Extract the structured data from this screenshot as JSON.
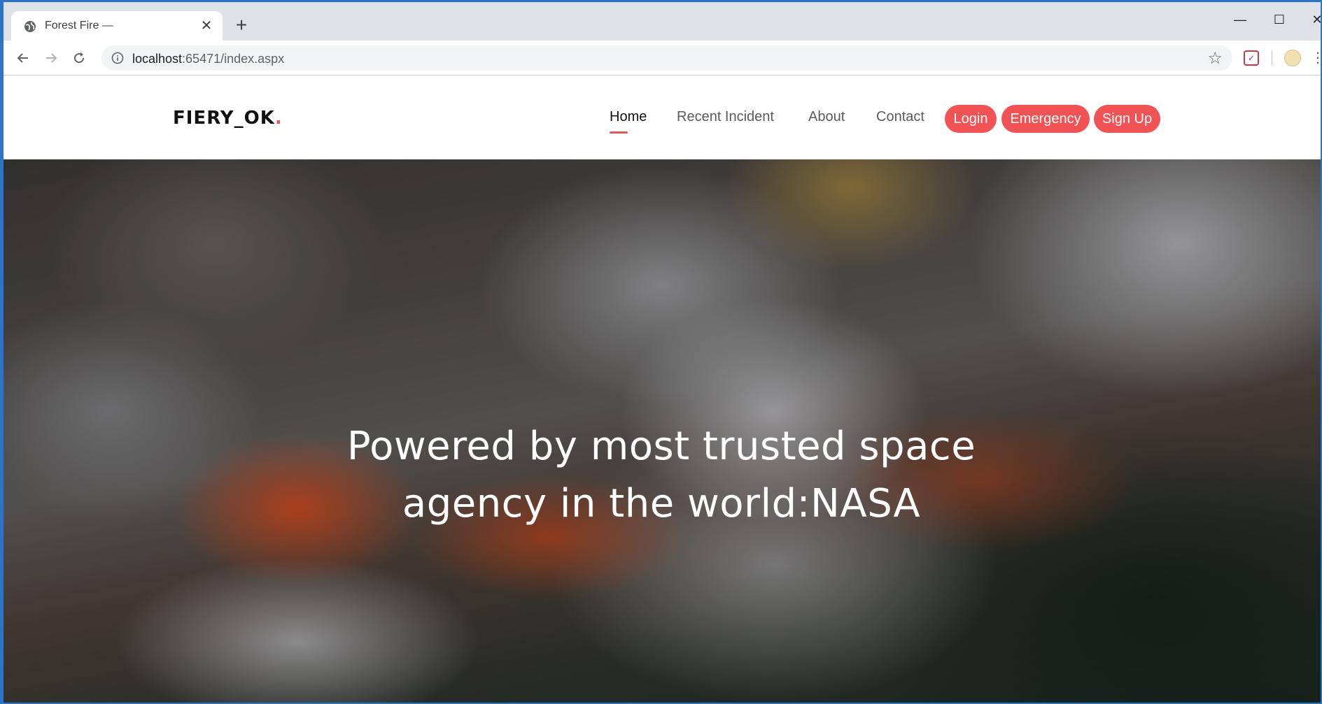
{
  "browser": {
    "tab_title": "Forest Fire —",
    "tab_close": "✕",
    "new_tab": "+",
    "url_host": "localhost",
    "url_path": ":65471/index.aspx",
    "window_controls": {
      "minimize": "—",
      "maximize": "☐",
      "close": "✕"
    },
    "icons": [
      "globe-icon",
      "back-arrow-icon",
      "forward-arrow-icon",
      "reload-icon",
      "info-icon",
      "star-icon",
      "pocket-icon",
      "profile-avatar",
      "menu-dots-icon"
    ]
  },
  "site": {
    "logo_text": "FIERY_OK",
    "logo_dot": ".",
    "nav": {
      "home": "Home",
      "recent_incident": "Recent Incident",
      "about": "About",
      "contact": "Contact"
    },
    "buttons": {
      "login": "Login",
      "emergency": "Emergency",
      "signup": "Sign Up"
    },
    "hero": {
      "line1": "Powered by most trusted space",
      "line2": "agency in the world:NASA"
    },
    "colors": {
      "accent": "#f15354"
    }
  }
}
